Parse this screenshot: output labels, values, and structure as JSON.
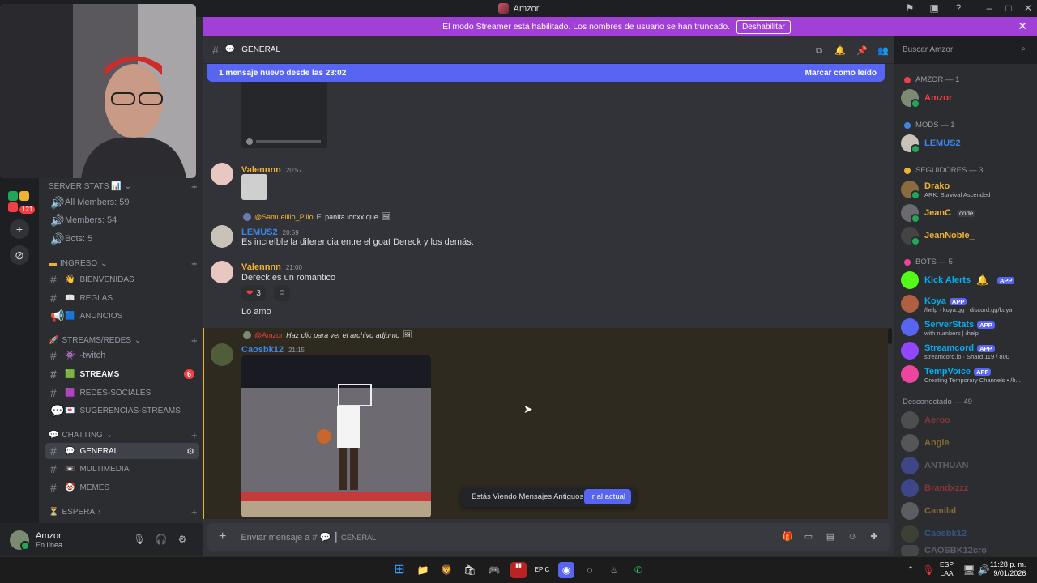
{
  "window": {
    "title": "Amzor"
  },
  "banner": {
    "text": "El modo Streamer está habilitado. Los nombres de usuario se han truncado.",
    "button": "Deshabilitar"
  },
  "server_badges": {
    "pill": "121"
  },
  "channel_header": {
    "name": "GENERAL"
  },
  "new_messages_bar": {
    "text": "1 mensaje nuevo desde las 23:02",
    "action": "Marcar como leído"
  },
  "search": {
    "placeholder": "Buscar Amzor"
  },
  "sidebar": {
    "server_stats": {
      "label": "SERVER STATS 📊",
      "items": [
        "All Members: 59",
        "Members: 54",
        "Bots: 5"
      ]
    },
    "categories": [
      {
        "label": "INGRESO",
        "channels": [
          {
            "name": "BIENVENIDAS"
          },
          {
            "name": "REGLAS"
          },
          {
            "name": "ANUNCIOS"
          }
        ]
      },
      {
        "label": "STREAMS/REDES",
        "channels": [
          {
            "name": "-twitch"
          },
          {
            "name": "STREAMS",
            "badge": "6"
          },
          {
            "name": "REDES-SOCIALES"
          },
          {
            "name": "SUGERENCIAS-STREAMS"
          }
        ]
      },
      {
        "label": "CHATTING",
        "channels": [
          {
            "name": "GENERAL"
          },
          {
            "name": "MULTIMEDIA"
          },
          {
            "name": "MEMES"
          }
        ]
      },
      {
        "label": "ESPERA",
        "channels": []
      }
    ]
  },
  "user_panel": {
    "name": "Amzor",
    "status": "En línea"
  },
  "messages": [
    {
      "author": "Valennnn",
      "time": "20:57",
      "color": "#f0b232"
    },
    {
      "reply_to": "@Samuelillo_Pillo",
      "reply_text": "El panita lonxx que",
      "author": "LEMUS2",
      "time": "20:59",
      "text": "Es increíble la diferencia entre el goat Dereck y los demás.",
      "color": "#3d86e8"
    },
    {
      "author": "Valennnn",
      "time": "21:00",
      "text": "Dereck es un romántico",
      "reaction_count": "3",
      "text2": "Lo amo",
      "color": "#f0b232"
    },
    {
      "reply_to": "@Amzor",
      "reply_text": "Haz clic para ver el archivo adjunto",
      "author": "Caosbk12",
      "time": "21:15",
      "color": "#3d86e8"
    }
  ],
  "old_messages": {
    "text": "Estás Viendo Mensajes Antiguos",
    "button": "Ir al actual"
  },
  "composer": {
    "placeholder": "Enviar mensaje a #",
    "channel": "GENERAL"
  },
  "members": {
    "groups": [
      {
        "label": "AMZOR — 1",
        "color": "#f23f43"
      },
      {
        "label": "MODS — 1",
        "color": "#3d86e8"
      },
      {
        "label": "SEGUIDORES — 3",
        "color": "#f0b232"
      },
      {
        "label": "BOTS — 5",
        "color": "#eb459e"
      }
    ],
    "amzor": [
      {
        "name": "Amzor",
        "color": "#f23f43"
      }
    ],
    "mods": [
      {
        "name": "LEMUS2",
        "color": "#3d86e8"
      }
    ],
    "seguidores": [
      {
        "name": "Drako",
        "status": "ARK: Survival Ascended",
        "color": "#f0b232"
      },
      {
        "name": "JeanC",
        "tag": "codé",
        "color": "#f0b232"
      },
      {
        "name": "JeanNoble_",
        "color": "#f0b232"
      }
    ],
    "bots": [
      {
        "name": "Kick Alerts",
        "status": "",
        "color": "#00b0f4"
      },
      {
        "name": "Koya",
        "status": "/help · koya.gg · discord.gg/koya",
        "color": "#00b0f4"
      },
      {
        "name": "ServerStats",
        "status": "with numbers | /help",
        "color": "#00b0f4"
      },
      {
        "name": "Streamcord",
        "status": "streamcord.io · Shard 119 / 800",
        "color": "#00b0f4"
      },
      {
        "name": "TempVoice",
        "status": "Creating Temporary Channels • /h...",
        "color": "#00b0f4"
      }
    ],
    "app_tag": "APP",
    "offline_label": "Desconectado — 49",
    "offline": [
      {
        "name": "Aeroo",
        "color": "#f23f43"
      },
      {
        "name": "Angie",
        "color": "#f0b232"
      },
      {
        "name": "ANTHUAN",
        "color": "#949ba4"
      },
      {
        "name": "Brandxzzz",
        "color": "#f23f43"
      },
      {
        "name": "Camilal",
        "color": "#f0b232"
      },
      {
        "name": "Caosbk12",
        "color": "#3d86e8"
      },
      {
        "name": "CAOSBK12cro",
        "color": "#949ba4"
      }
    ]
  },
  "taskbar": {
    "lang": "ESP",
    "lang2": "LAA",
    "time": "11:28 p. m.",
    "date": "9/01/2026"
  }
}
